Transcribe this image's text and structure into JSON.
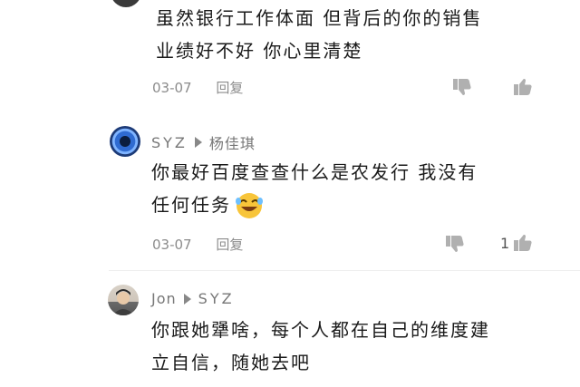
{
  "comments": [
    {
      "text_lines": [
        "虽然银行工作体面  但背后的你的销售",
        "业绩好不好 你心里清楚"
      ],
      "date": "03-07",
      "reply_label": "回复",
      "likes": ""
    },
    {
      "user": "SYZ",
      "reply_to": "杨佳琪",
      "text_lines": [
        "你最好百度查查什么是农发行 我没有",
        "任何任务"
      ],
      "date": "03-07",
      "reply_label": "回复",
      "likes": "1"
    },
    {
      "user": "Jon",
      "reply_to": "SYZ",
      "text_lines": [
        "你跟她犟啥，每个人都在自己的维度建",
        "立自信，随她去吧"
      ]
    }
  ],
  "icons": {
    "dislike": "thumbs-down-icon",
    "like": "thumbs-up-icon",
    "emoji": "laughing-emoji"
  }
}
